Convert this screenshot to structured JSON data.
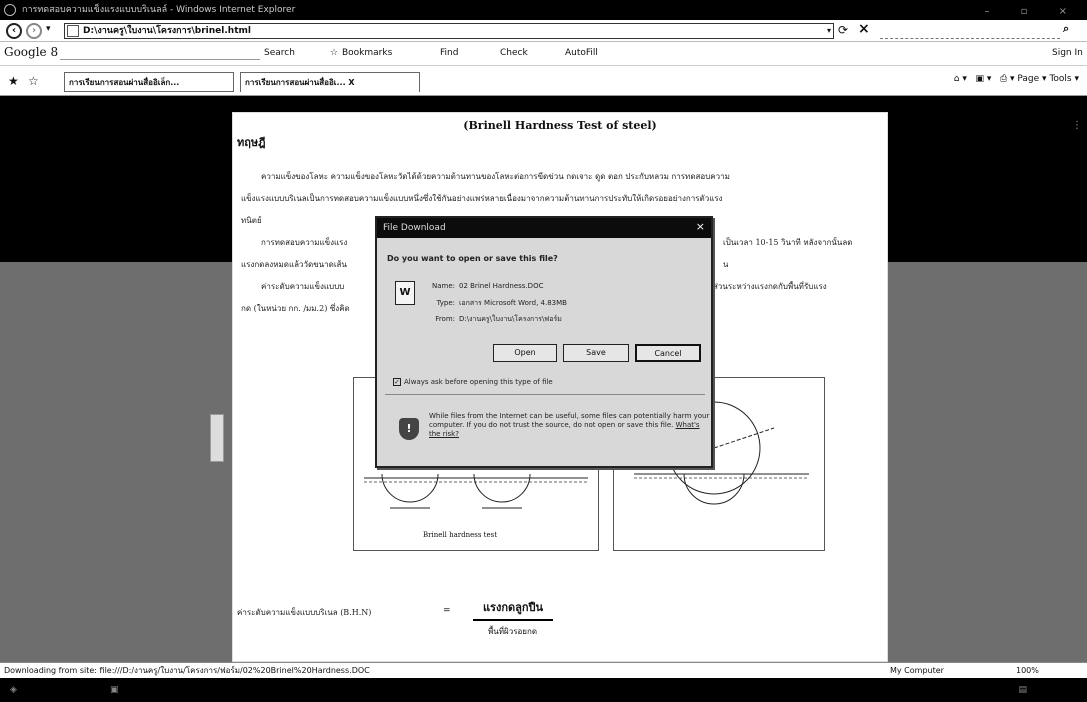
{
  "window": {
    "title": "การทดสอบความแข็งแรงแบบบริเนลล์ - Windows Internet Explorer"
  },
  "address_bar": {
    "url": "D:\\งานครู\\ใบงาน\\โครงการ\\brinel.html"
  },
  "google_toolbar": {
    "logo": "Google 8",
    "search_label": "Search",
    "bookmarks_label": "Bookmarks",
    "find_label": "Find",
    "check_label": "Check",
    "autofill_label": "AutoFill",
    "sign_in_label": "Sign In"
  },
  "tabs": [
    {
      "label": "การเรียนการสอนผ่านสื่ออิเล็ก..."
    },
    {
      "label": "การเรียนการสอนผ่านสื่ออิเ... X"
    }
  ],
  "command_bar": {
    "page_label": "Page",
    "tools_label": "Tools"
  },
  "document": {
    "title": "(Brinell Hardness Test of steel)",
    "section_heading": "ทฤษฎี",
    "paragraph1_line1": "ความแข็งของโลหะ ความแข็งของโลหะวัดได้ด้วยความต้านทานของโลหะต่อการขีดข่วน กดเจาะ ดูด ตอก ประกับหลวม การทดสอบความ",
    "paragraph1_line2": "แข็งแรงแบบบริเนลเป็นการทดสอบความแข็งแบบหนึ่งซึ่งใช้กันอย่างแพร่หลายเนื่องมาจากความต้านทานการประทับให้เกิดรอยอย่างการตัวแรง",
    "paragraph1_line3": "ทนิตย์",
    "paragraph2_line1": "การทดสอบความแข็งแรง",
    "paragraph2_tail": "เป็นเวลา 10-15 วินาที หลังจากนั้นลด",
    "paragraph2_line2": "แรงกดลงหมดแล้ววัดขนาดเส้น",
    "paragraph2_line2_tail": "น",
    "paragraph3_line1": "ค่าระดับความแข็งแบบบ",
    "paragraph3_tail": "ส่วนระหว่างแรงกดกับพื้นที่รับแรง",
    "paragraph3_line2": "กด (ในหน่วย กก. /มม.2) ซึ่งคิด",
    "figure_caption": "Brinell hardness test",
    "formula_label": "ค่าระดับความแข็งแบบบริเนล (B.H.N)",
    "formula_eq": "=",
    "formula_numerator": "แรงกดลูกปืน",
    "formula_denominator": "พื้นที่ผิวรอยกด"
  },
  "dialog": {
    "title": "File Download",
    "question": "Do you want to open or save this file?",
    "name_label": "Name:",
    "name_value": "02 Brinel Hardness.DOC",
    "type_label": "Type:",
    "type_value": "เอกสาร Microsoft Word, 4.83MB",
    "from_label": "From:",
    "from_value": "D:\\งานครู\\ใบงาน\\โครงการ\\ฟอร์ม",
    "open_label": "Open",
    "save_label": "Save",
    "cancel_label": "Cancel",
    "checkbox_label": "Always ask before opening this type of file",
    "warning_text": "While files from the Internet can be useful, some files can potentially harm your computer. If you do not trust the source, do not open or save this file.",
    "risk_link": "What's the risk?"
  },
  "status_bar": {
    "status_text": "Downloading from site: file:///D:/งานครู/ใบงาน/โครงการ/ฟอร์ม/02%20Brinel%20Hardness.DOC",
    "zone": "My Computer",
    "zoom": "100%"
  }
}
